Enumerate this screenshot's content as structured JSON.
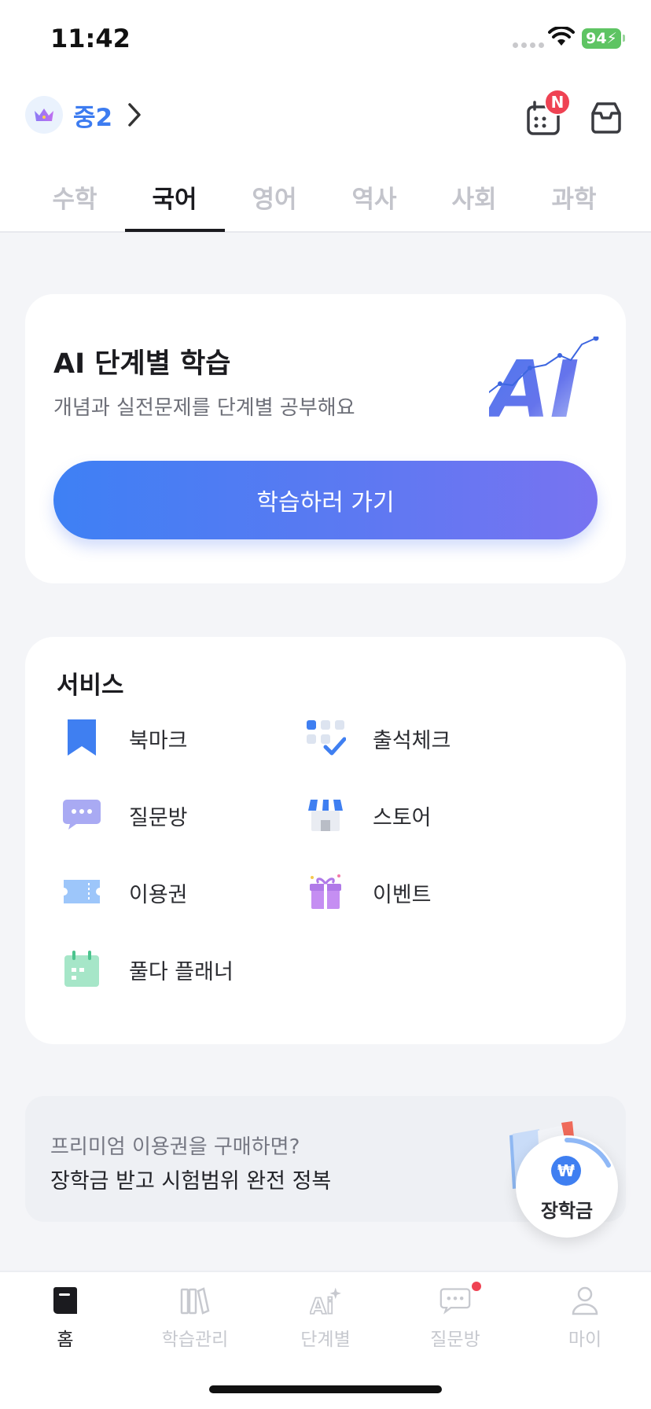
{
  "status_bar": {
    "time": "11:42",
    "battery": "94",
    "icons": [
      "signal-icon",
      "wifi-icon",
      "battery-charging-icon"
    ]
  },
  "header": {
    "grade": "중2",
    "grade_icon": "crown-icon",
    "calendar_badge": "N",
    "icons": [
      "chevron-right-icon",
      "calendar-icon",
      "inbox-icon"
    ]
  },
  "subject_tabs": [
    {
      "label": "수학",
      "active": false
    },
    {
      "label": "국어",
      "active": true
    },
    {
      "label": "영어",
      "active": false
    },
    {
      "label": "역사",
      "active": false
    },
    {
      "label": "사회",
      "active": false
    },
    {
      "label": "과학",
      "active": false
    }
  ],
  "ai_card": {
    "title": "AI 단계별 학습",
    "description": "개념과 실전문제를 단계별 공부해요",
    "button_label": "학습하러 가기",
    "logo_text": "AI"
  },
  "services": {
    "title": "서비스",
    "items": [
      {
        "label": "북마크",
        "icon": "bookmark-icon"
      },
      {
        "label": "출석체크",
        "icon": "attendance-check-icon"
      },
      {
        "label": "질문방",
        "icon": "chat-bubble-icon"
      },
      {
        "label": "스토어",
        "icon": "store-icon"
      },
      {
        "label": "이용권",
        "icon": "ticket-icon"
      },
      {
        "label": "이벤트",
        "icon": "gift-icon"
      },
      {
        "label": "풀다 플래너",
        "icon": "planner-calendar-icon"
      }
    ]
  },
  "promo": {
    "subtitle": "프리미엄 이용권을 구매하면?",
    "headline": "장학금 받고 시험범위 완전 정복"
  },
  "scholarship_button": {
    "label": "장학금",
    "coin_symbol": "₩"
  },
  "bottom_nav": [
    {
      "label": "홈",
      "icon": "home-book-icon",
      "active": true
    },
    {
      "label": "학습관리",
      "icon": "books-icon",
      "active": false
    },
    {
      "label": "단계별",
      "icon": "ai-sparkle-icon",
      "active": false
    },
    {
      "label": "질문방",
      "icon": "chat-icon",
      "active": false,
      "notification": true
    },
    {
      "label": "마이",
      "icon": "person-icon",
      "active": false
    }
  ],
  "colors": {
    "accent": "#3d7cf0",
    "button_gradient_start": "#3e80f4",
    "button_gradient_end": "#7873f1",
    "notification": "#ef4253",
    "battery": "#5ec463"
  }
}
